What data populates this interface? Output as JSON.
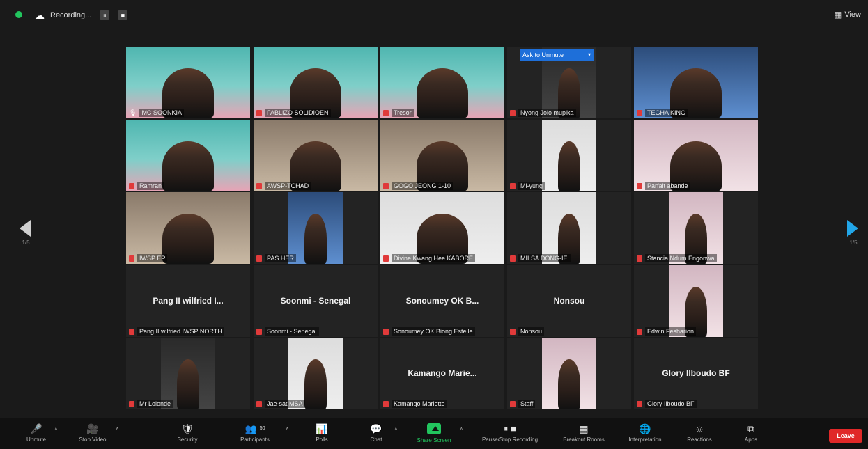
{
  "top": {
    "recording_label": "Recording...",
    "pause_glyph": "⏸",
    "stop_glyph": "■",
    "view_label": "View"
  },
  "nav": {
    "left_page": "1/5",
    "right_page": "1/5"
  },
  "admit": {
    "label": "Ask to Unmute",
    "caret": "▾"
  },
  "tiles": [
    {
      "name": "MC SOONKIA",
      "type": "video",
      "video": "v-teal",
      "active": true,
      "muted": false
    },
    {
      "name": "FABLIZO SOLIDIOEN",
      "type": "video",
      "video": "v-teal",
      "active": false,
      "muted": true
    },
    {
      "name": "Tresor",
      "type": "video",
      "video": "v-teal",
      "active": false,
      "muted": true
    },
    {
      "name": "Nyong Jolo mupika",
      "type": "video",
      "video": "v-dark",
      "active": false,
      "muted": true
    },
    {
      "name": "TEGHA KING",
      "type": "video",
      "video": "v-blue",
      "active": false,
      "muted": true
    },
    {
      "name": "Ramran",
      "type": "video",
      "video": "v-teal",
      "active": false,
      "muted": true
    },
    {
      "name": "AWSP-TCHAD",
      "type": "video",
      "video": "v-room",
      "active": false,
      "muted": true
    },
    {
      "name": "GOGO JEONG 1-10",
      "type": "video",
      "video": "v-room",
      "active": false,
      "muted": true
    },
    {
      "name": "Mi-yung",
      "type": "video",
      "video": "v-light",
      "active": false,
      "muted": true
    },
    {
      "name": "Parfait abande",
      "type": "video",
      "video": "v-pink",
      "active": false,
      "muted": true
    },
    {
      "name": "IWSP EP",
      "type": "video",
      "video": "v-room",
      "active": false,
      "muted": true
    },
    {
      "name": "PAS HER",
      "type": "video",
      "video": "v-blue",
      "active": false,
      "muted": true
    },
    {
      "name": "Divine Kwang Hee KABORE",
      "type": "video",
      "video": "v-light",
      "active": false,
      "muted": true
    },
    {
      "name": "MILSA DONG-IEl",
      "type": "video",
      "video": "v-light",
      "active": false,
      "muted": true
    },
    {
      "name": "Stancia Ndum Engonwa",
      "type": "video",
      "video": "v-pink",
      "active": false,
      "muted": true
    },
    {
      "name": "Pang II wilfried IWSP NORTH",
      "type": "text",
      "big": "Pang II wilfried I...",
      "muted": true
    },
    {
      "name": "Soonmi - Senegal",
      "type": "text",
      "big": "Soonmi - Senegal",
      "muted": true
    },
    {
      "name": "Sonoumey OK Biong Estelle",
      "type": "text",
      "big": "Sonoumey OK B...",
      "muted": true
    },
    {
      "name": "Nonsou",
      "type": "text",
      "big": "Nonsou",
      "muted": true
    },
    {
      "name": "Edwin Fesharion",
      "type": "video",
      "video": "v-pink",
      "active": false,
      "muted": true
    },
    {
      "name": "Mr Lolonde",
      "type": "video",
      "video": "v-dark",
      "active": false,
      "muted": true
    },
    {
      "name": "Jae-sat MSA",
      "type": "video",
      "video": "v-light",
      "active": false,
      "muted": true
    },
    {
      "name": "Kamango Mariette",
      "type": "text",
      "big": "Kamango  Marie...",
      "muted": true
    },
    {
      "name": "Staff",
      "type": "video",
      "video": "v-pink",
      "active": false,
      "muted": true
    },
    {
      "name": "Glory Ilboudo BF",
      "type": "text",
      "big": "Glory Ilboudo BF",
      "muted": true
    }
  ],
  "toolbar": {
    "unmute": "Unmute",
    "stop_video": "Stop Video",
    "security": "Security",
    "participants": "Participants",
    "participants_count": "50",
    "polls": "Polls",
    "chat": "Chat",
    "share_screen": "Share Screen",
    "pause_stop_recording": "Pause/Stop Recording",
    "breakout_rooms": "Breakout Rooms",
    "interpretation": "Interpretation",
    "reactions": "Reactions",
    "apps": "Apps",
    "leave": "Leave"
  },
  "icons": {
    "mic": "🎤",
    "camera": "🎥",
    "shield": "🛡",
    "people": "👥",
    "polls": "📊",
    "chat": "💬",
    "rec": "⏺",
    "grid": "▦",
    "globe": "🌐",
    "smile": "☺",
    "apps": "⧉",
    "caret": "˄"
  },
  "colors": {
    "active_border": "#d6e64a",
    "share_green": "#22c55e",
    "leave_red": "#e02828",
    "admit_blue": "#1e6fd9",
    "nav_right": "#22a6e8"
  }
}
